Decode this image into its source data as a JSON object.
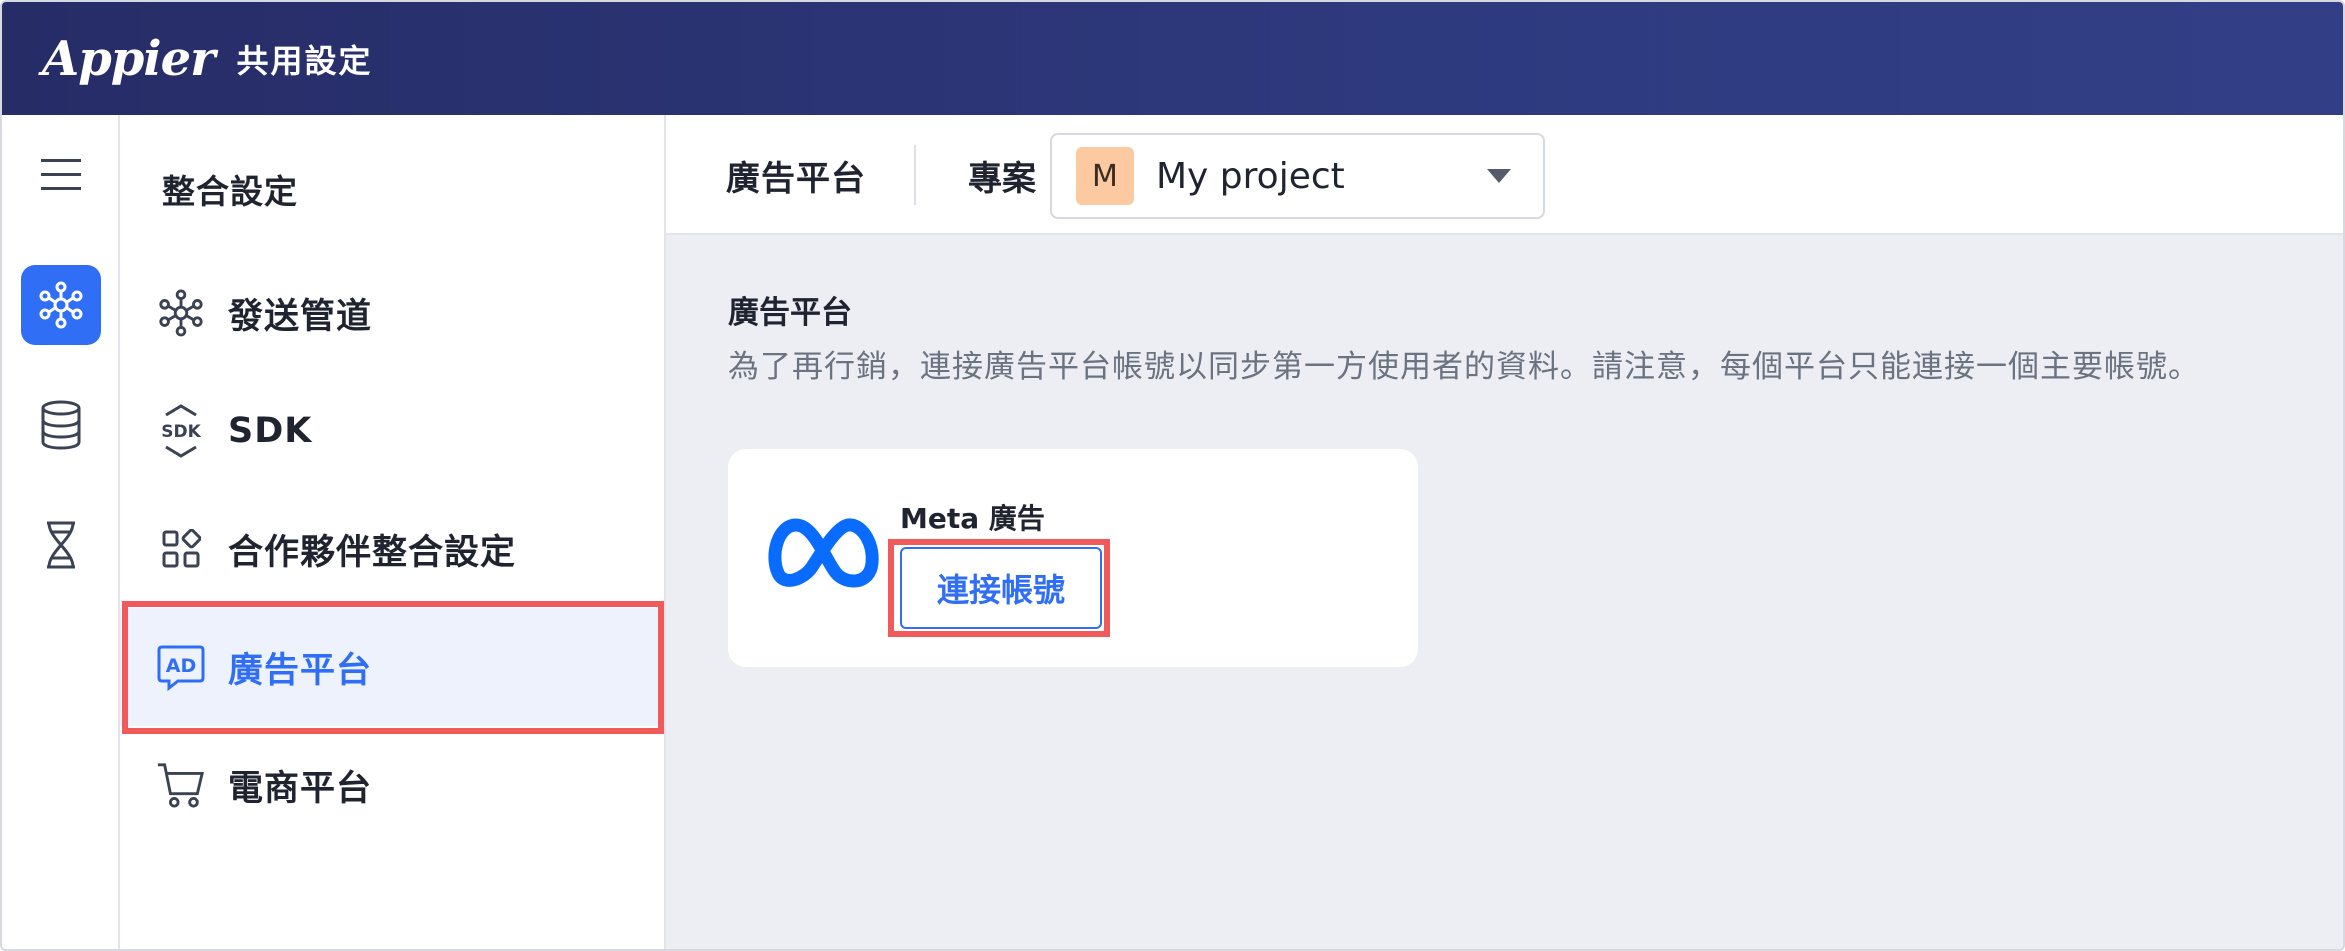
{
  "header": {
    "logo_text": "Appier",
    "app_title": "共用設定"
  },
  "rail": {
    "items": [
      {
        "icon": "hamburger-menu-icon",
        "active": false
      },
      {
        "icon": "integration-nodes-icon",
        "active": true
      },
      {
        "icon": "database-icon",
        "active": false
      },
      {
        "icon": "dna-icon",
        "active": false
      }
    ]
  },
  "subnav": {
    "title": "整合設定",
    "items": [
      {
        "label": "發送管道",
        "icon": "nodes-icon",
        "active": false
      },
      {
        "label": "SDK",
        "icon": "sdk-icon",
        "active": false
      },
      {
        "label": "合作夥伴整合設定",
        "icon": "apps-grid-icon",
        "active": false
      },
      {
        "label": "廣告平台",
        "icon": "ad-icon",
        "active": true
      },
      {
        "label": "電商平台",
        "icon": "cart-icon",
        "active": false
      }
    ]
  },
  "toolbar": {
    "breadcrumb": "廣告平台",
    "project_label": "專案",
    "project": {
      "avatar_letter": "M",
      "name": "My project"
    }
  },
  "content": {
    "section_title": "廣告平台",
    "section_desc": "為了再行銷，連接廣告平台帳號以同步第一方使用者的資料。請注意，每個平台只能連接一個主要帳號。",
    "card": {
      "title": "Meta 廣告",
      "button_label": "連接帳號",
      "icon": "meta-logo-icon"
    }
  },
  "colors": {
    "header_bg": "#2e3a7e",
    "accent": "#2f6ef5",
    "highlight": "#f05a5a",
    "main_bg": "#eceef3"
  }
}
